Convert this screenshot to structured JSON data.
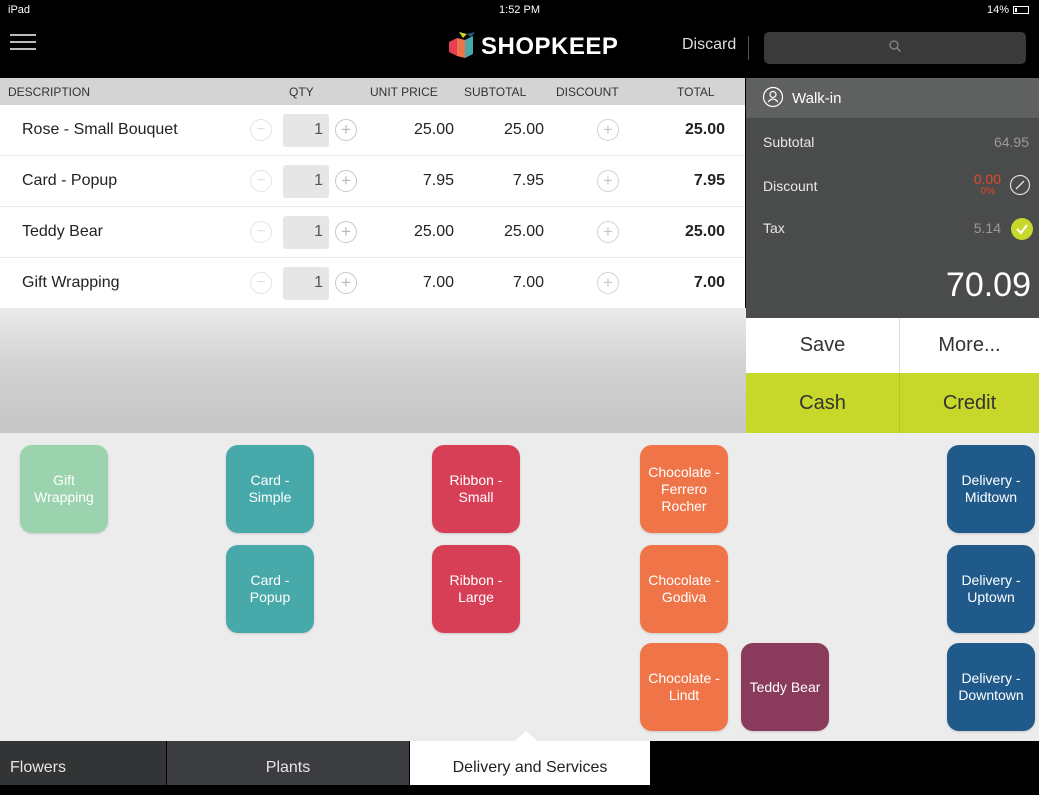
{
  "status_bar": {
    "device": "iPad",
    "time": "1:52 PM",
    "battery": "14%"
  },
  "header": {
    "brand": "SHOPKEEP",
    "discard_label": "Discard",
    "search_placeholder": ""
  },
  "table": {
    "columns": [
      "DESCRIPTION",
      "QTY",
      "UNIT PRICE",
      "SUBTOTAL",
      "DISCOUNT",
      "TOTAL"
    ],
    "rows": [
      {
        "description": "Rose - Small Bouquet",
        "qty": "1",
        "unit_price": "25.00",
        "subtotal": "25.00",
        "total": "25.00"
      },
      {
        "description": "Card - Popup",
        "qty": "1",
        "unit_price": "7.95",
        "subtotal": "7.95",
        "total": "7.95"
      },
      {
        "description": "Teddy Bear",
        "qty": "1",
        "unit_price": "25.00",
        "subtotal": "25.00",
        "total": "25.00"
      },
      {
        "description": "Gift Wrapping",
        "qty": "1",
        "unit_price": "7.00",
        "subtotal": "7.00",
        "total": "7.00"
      }
    ]
  },
  "summary": {
    "customer": "Walk-in",
    "subtotal_label": "Subtotal",
    "subtotal_value": "64.95",
    "discount_label": "Discount",
    "discount_value": "0.00",
    "discount_percent": "0%",
    "tax_label": "Tax",
    "tax_value": "5.14",
    "grand_total": "70.09"
  },
  "actions": {
    "save": "Save",
    "more": "More...",
    "cash": "Cash",
    "credit": "Credit"
  },
  "colors": {
    "accent": "#c7d82b",
    "mint": "#9ad3ae",
    "teal": "#47a9a9",
    "red": "#d63f55",
    "orange": "#ef7548",
    "plum": "#8a3a5a",
    "navy": "#1f5a8a"
  },
  "tiles": [
    {
      "label": "Gift Wrapping",
      "color": "#9ad3ae"
    },
    {
      "label": "Card - Simple",
      "color": "#47a9a9"
    },
    {
      "label": "Ribbon - Small",
      "color": "#d63f55"
    },
    {
      "label": "Chocolate - Ferrero Rocher",
      "color": "#ef7548"
    },
    {
      "label": "Delivery - Midtown",
      "color": "#1f5a8a"
    },
    {
      "label": "Card - Popup",
      "color": "#47a9a9"
    },
    {
      "label": "Ribbon - Large",
      "color": "#d63f55"
    },
    {
      "label": "Chocolate - Godiva",
      "color": "#ef7548"
    },
    {
      "label": "Delivery - Uptown",
      "color": "#1f5a8a"
    },
    {
      "label": "Chocolate - Lindt",
      "color": "#ef7548"
    },
    {
      "label": "Teddy Bear",
      "color": "#8a3a5a"
    },
    {
      "label": "Delivery - Downtown",
      "color": "#1f5a8a"
    }
  ],
  "tabs": {
    "flowers": "Flowers",
    "plants": "Plants",
    "delivery": "Delivery and Services"
  }
}
